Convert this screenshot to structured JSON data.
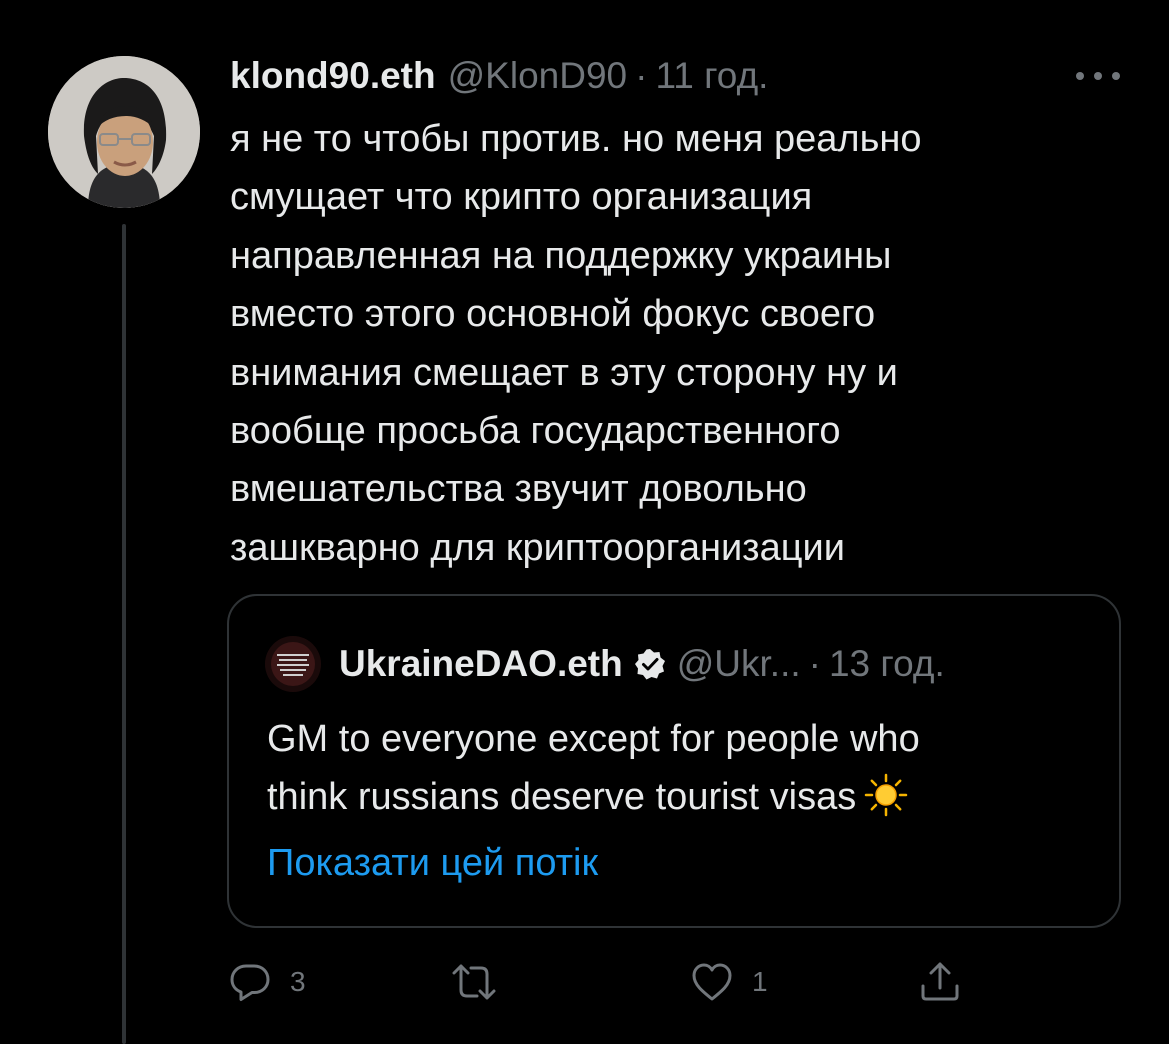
{
  "tweet": {
    "author": {
      "display_name": "klond90.eth",
      "handle": "@KlonD90",
      "separator": "·",
      "time": "11 год."
    },
    "text": "я не то чтобы против. но меня реально\nсмущает что крипто организация\nнаправленная на поддержку украины\nвместо этого основной фокус своего\nвнимания смещает в эту сторону ну и\nвообще просьба государственного\nвмешательства звучит довольно\nзашкварно для криптоорганизации",
    "more_icon": "more-horizontal-icon"
  },
  "quoted_tweet": {
    "display_name": "UkraineDAO.eth",
    "verified_icon": "verified-badge-icon",
    "handle": "@Ukr...",
    "separator": "·",
    "time": "13 год.",
    "text": "GM to everyone except for people who\nthink russians deserve tourist visas",
    "emoji_icon": "sun-icon",
    "show_thread_label": "Показати цей потік"
  },
  "actions": {
    "reply_count": "3",
    "retweet_count": "",
    "like_count": "1",
    "icons": [
      "reply-icon",
      "retweet-icon",
      "like-icon",
      "share-icon"
    ]
  },
  "colors": {
    "background": "#000000",
    "text": "#e7e9ea",
    "secondary": "#71767b",
    "border": "#2f3336",
    "link": "#1d9bf0"
  }
}
